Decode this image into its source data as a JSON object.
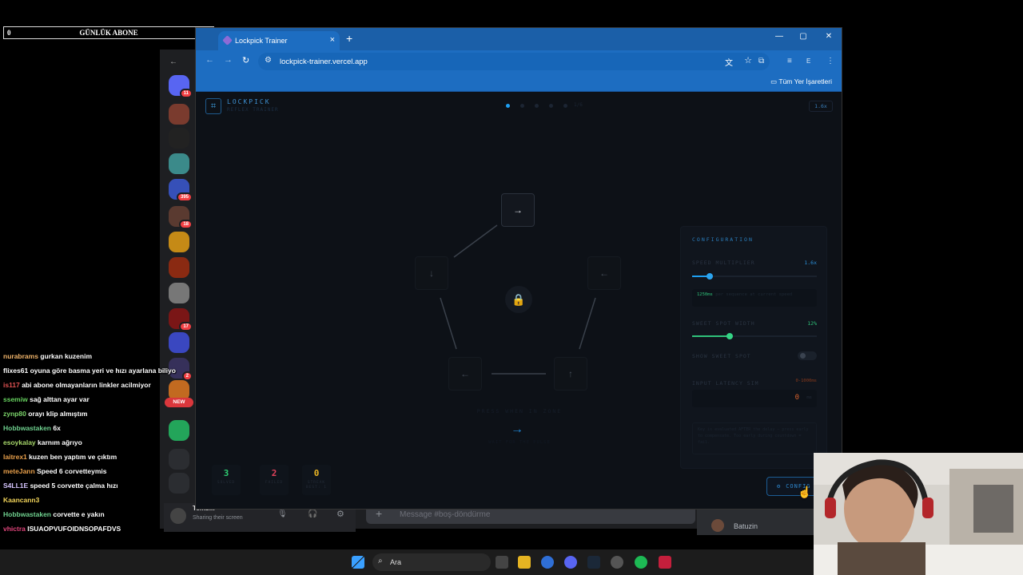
{
  "overlay": {
    "sub_left": "0",
    "sub_title": "GÜNLÜK ABONE",
    "sub_right": "5"
  },
  "chat": [
    {
      "user": "nurabrams",
      "text": "gurkan kuzenim",
      "color": "#f0b46a"
    },
    {
      "user": "flixes61",
      "text": "oyuna göre basma yeri ve hızı ayarlana biliyo",
      "color": "#ffffff"
    },
    {
      "user": "is117",
      "text": "abi abone olmayanların linkler acilmiyor",
      "color": "#e05252"
    },
    {
      "user": "ssemiw",
      "text": "sağ alttan ayar var",
      "color": "#66d15f"
    },
    {
      "user": "zynp80",
      "text": "orayı klip almıştım",
      "color": "#7bd36a"
    },
    {
      "user": "Hobbwastaken",
      "text": "6x",
      "color": "#6fd18f"
    },
    {
      "user": "esoykalay",
      "text": "karnım ağrıyo",
      "color": "#a8d86b"
    },
    {
      "user": "laitrex1",
      "text": "kuzen ben yaptım ve çıktım",
      "color": "#e9a04b"
    },
    {
      "user": "meteJann",
      "text": "Speed 6 corvetteymis",
      "color": "#e9a04b"
    },
    {
      "user": "S4LL1E",
      "text": "speed 5 corvette çalma hızı",
      "color": "#d7c6ff"
    },
    {
      "user": "Kaancann3",
      "text": "",
      "color": "#f2d45a"
    },
    {
      "user": "Hobbwastaken",
      "text": "corvette e yakın",
      "color": "#6fd18f"
    },
    {
      "user": "vhictra",
      "text": "ISUAOPVUFOIDNSOPAFDVS",
      "color": "#e0457b"
    }
  ],
  "discord": {
    "badges": [
      "11",
      "395",
      "18",
      "17",
      "2"
    ],
    "new_label": "NEW",
    "user_name": "Tembik",
    "user_status": "Sharing their screen",
    "message_placeholder": "Message #boş-döndürme",
    "member_name": "Batuzin"
  },
  "browser": {
    "tab_title": "Lockpick Trainer",
    "url": "lockpick-trainer.vercel.app",
    "bookmarks_label": "Tüm Yer İşaretleri",
    "profile_initial": "E"
  },
  "app": {
    "logo_title": "LOCKPICK",
    "logo_subtitle": "REFLEX TRAINER",
    "progress_label": "1/6",
    "speed_badge": "1.6x",
    "arrows": {
      "top": "→",
      "left": "↓",
      "right": "←",
      "bottom_left": "←",
      "bottom_right": "↑"
    },
    "lock_icon": "🔒",
    "hint": "PRESS WHEN IN ZONE",
    "target_arrow": "→",
    "hint2": "WAIT FOR THE PULSE",
    "stats": [
      {
        "value": "3",
        "label": "SOLVED",
        "color": "#2ecc71"
      },
      {
        "value": "2",
        "label": "FAILED",
        "color": "#e0425a"
      },
      {
        "value": "0",
        "label": "STREAK",
        "sub": "BEST: 1",
        "color": "#e8b323"
      }
    ],
    "config": {
      "title": "CONFIGURATION",
      "speed_label": "SPEED MULTIPLIER",
      "speed_value": "1.6x",
      "speed_level": 0.14,
      "speed_info_ms": "1250ms",
      "speed_info_text": "per sequence at current speed",
      "sweet_label": "SWEET SPOT WIDTH",
      "sweet_value": "12%",
      "sweet_level": 0.3,
      "show_label": "SHOW SWEET SPOT",
      "show_on": false,
      "latency_label": "INPUT LATENCY SIM",
      "latency_range": "0-1000ms",
      "latency_value": "0",
      "latency_unit": "ms",
      "note": "Key is evaluated AFTER the delay — press early to compensate. Too early during countdown = fail."
    },
    "config_button": "CONFIG"
  },
  "taskbar": {
    "search_label": "Ara"
  },
  "colors": {
    "accent": "#1e9ff2",
    "chrome_blue": "#1d6dc1",
    "bg": "#0d1117"
  }
}
